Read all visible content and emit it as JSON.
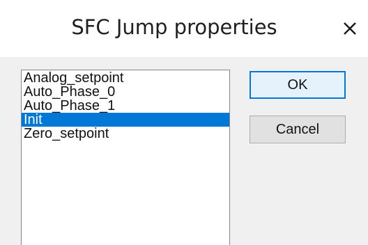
{
  "dialog": {
    "title": "SFC Jump properties",
    "close_icon": "close-icon"
  },
  "listbox": {
    "items": [
      {
        "label": "Analog_setpoint",
        "selected": false
      },
      {
        "label": "Auto_Phase_0",
        "selected": false
      },
      {
        "label": "Auto_Phase_1",
        "selected": false
      },
      {
        "label": "Init",
        "selected": true
      },
      {
        "label": "Zero_setpoint",
        "selected": false
      }
    ]
  },
  "buttons": {
    "ok_label": "OK",
    "cancel_label": "Cancel"
  },
  "colors": {
    "selection": "#0078d7",
    "default_button_border": "#0078d7",
    "default_button_bg": "#e5f1fb",
    "client_bg": "#f0f0f0"
  }
}
